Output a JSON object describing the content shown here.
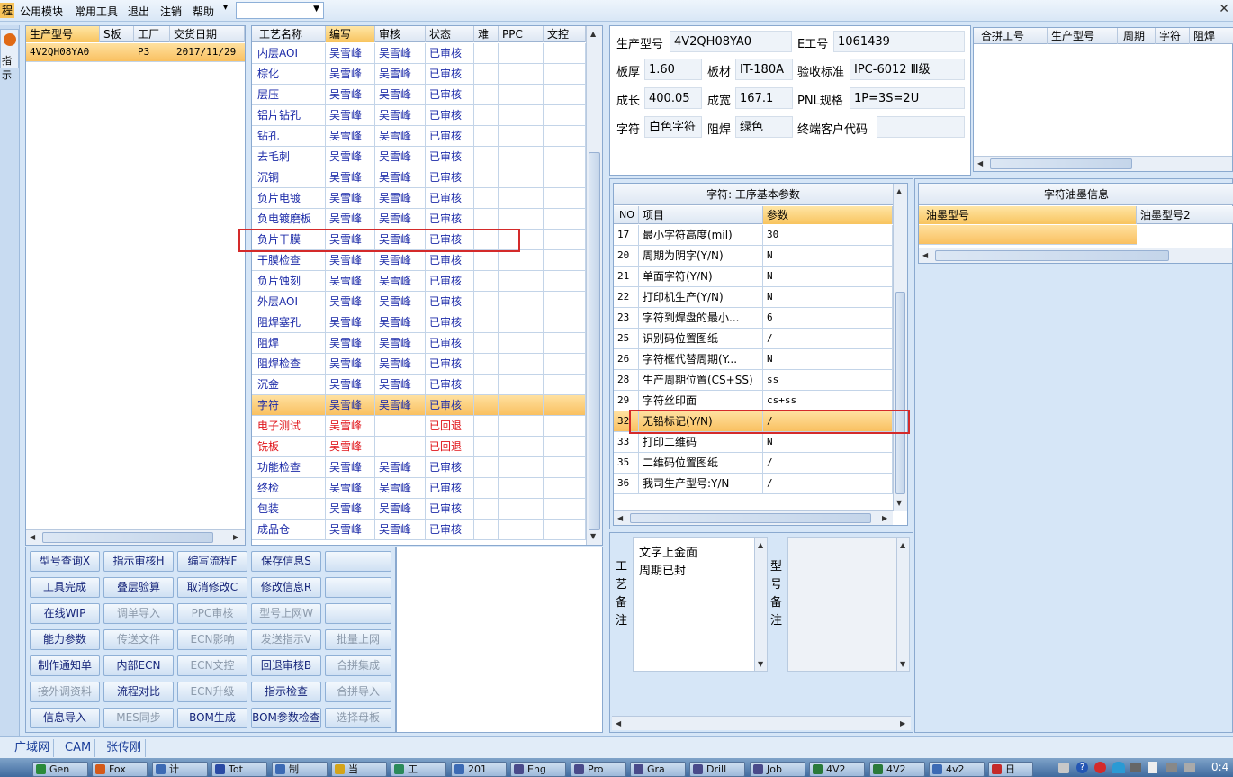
{
  "menu": {
    "partial_left": "程",
    "items": [
      "公用模块",
      "常用工具",
      "退出",
      "注销",
      "帮助"
    ],
    "arrow": "▾"
  },
  "left_strip": {
    "label": "指示"
  },
  "model_list": {
    "columns": [
      "生产型号",
      "S板",
      "工厂",
      "交货日期"
    ],
    "rows": [
      [
        "4V2QH08YA0",
        "",
        "P3",
        "2017/11/29"
      ]
    ]
  },
  "process_table": {
    "columns": [
      "工艺名称",
      "编写",
      "审核",
      "状态",
      "难",
      "PPC",
      "文控"
    ],
    "rows": [
      {
        "name": "内层AOI",
        "writer": "吴雪峰",
        "reviewer": "吴雪峰",
        "status": "已审核"
      },
      {
        "name": "棕化",
        "writer": "吴雪峰",
        "reviewer": "吴雪峰",
        "status": "已审核"
      },
      {
        "name": "层压",
        "writer": "吴雪峰",
        "reviewer": "吴雪峰",
        "status": "已审核"
      },
      {
        "name": "铝片钻孔",
        "writer": "吴雪峰",
        "reviewer": "吴雪峰",
        "status": "已审核"
      },
      {
        "name": "钻孔",
        "writer": "吴雪峰",
        "reviewer": "吴雪峰",
        "status": "已审核"
      },
      {
        "name": "去毛刺",
        "writer": "吴雪峰",
        "reviewer": "吴雪峰",
        "status": "已审核"
      },
      {
        "name": "沉铜",
        "writer": "吴雪峰",
        "reviewer": "吴雪峰",
        "status": "已审核"
      },
      {
        "name": "负片电镀",
        "writer": "吴雪峰",
        "reviewer": "吴雪峰",
        "status": "已审核"
      },
      {
        "name": "负电镀磨板",
        "writer": "吴雪峰",
        "reviewer": "吴雪峰",
        "status": "已审核"
      },
      {
        "name": "负片干膜",
        "writer": "吴雪峰",
        "reviewer": "吴雪峰",
        "status": "已审核"
      },
      {
        "name": "干膜检查",
        "writer": "吴雪峰",
        "reviewer": "吴雪峰",
        "status": "已审核"
      },
      {
        "name": "负片蚀刻",
        "writer": "吴雪峰",
        "reviewer": "吴雪峰",
        "status": "已审核"
      },
      {
        "name": "外层AOI",
        "writer": "吴雪峰",
        "reviewer": "吴雪峰",
        "status": "已审核"
      },
      {
        "name": "阻焊塞孔",
        "writer": "吴雪峰",
        "reviewer": "吴雪峰",
        "status": "已审核"
      },
      {
        "name": "阻焊",
        "writer": "吴雪峰",
        "reviewer": "吴雪峰",
        "status": "已审核"
      },
      {
        "name": "阻焊检查",
        "writer": "吴雪峰",
        "reviewer": "吴雪峰",
        "status": "已审核"
      },
      {
        "name": "沉金",
        "writer": "吴雪峰",
        "reviewer": "吴雪峰",
        "status": "已审核"
      },
      {
        "name": "字符",
        "writer": "吴雪峰",
        "reviewer": "吴雪峰",
        "status": "已审核"
      },
      {
        "name": "电子测试",
        "writer": "吴雪峰",
        "reviewer": "",
        "status": "已回退"
      },
      {
        "name": "铣板",
        "writer": "吴雪峰",
        "reviewer": "",
        "status": "已回退"
      },
      {
        "name": "功能检查",
        "writer": "吴雪峰",
        "reviewer": "吴雪峰",
        "status": "已审核"
      },
      {
        "name": "终检",
        "writer": "吴雪峰",
        "reviewer": "吴雪峰",
        "status": "已审核"
      },
      {
        "name": "包装",
        "writer": "吴雪峰",
        "reviewer": "吴雪峰",
        "status": "已审核"
      },
      {
        "name": "成品仓",
        "writer": "吴雪峰",
        "reviewer": "吴雪峰",
        "status": "已审核"
      }
    ]
  },
  "buttons": [
    [
      "型号查询X",
      "指示审核H",
      "编写流程F",
      "保存信息S",
      ""
    ],
    [
      "工具完成",
      "叠层验算",
      "取消修改C",
      "修改信息R",
      ""
    ],
    [
      "在线WIP",
      "调单导入",
      "PPC审核",
      "型号上网W",
      ""
    ],
    [
      "能力参数",
      "传送文件",
      "ECN影响",
      "发送指示V",
      "批量上网"
    ],
    [
      "制作通知单",
      "内部ECN",
      "ECN文控",
      "回退审核B",
      "合拼集成"
    ],
    [
      "接外调资料",
      "流程对比",
      "ECN升级",
      "指示检查",
      "合拼导入"
    ],
    [
      "信息导入",
      "MES同步",
      "BOM生成",
      "BOM参数检查",
      "选择母板"
    ]
  ],
  "buttons_disabled": [
    [
      false,
      false,
      false,
      false,
      false
    ],
    [
      false,
      false,
      false,
      false,
      false
    ],
    [
      false,
      true,
      true,
      true,
      false
    ],
    [
      false,
      true,
      true,
      true,
      true
    ],
    [
      false,
      false,
      true,
      false,
      true
    ],
    [
      true,
      false,
      true,
      false,
      true
    ],
    [
      false,
      true,
      false,
      false,
      true
    ]
  ],
  "info": {
    "model_label": "生产型号",
    "model": "4V2QH08YA0",
    "eng_label": "E工号",
    "eng": "1061439",
    "thick_label": "板厚",
    "thick": "1.60",
    "mat_label": "板材",
    "mat": "IT-180A",
    "std_label": "验收标准",
    "std": "IPC-6012 Ⅲ级",
    "len_label": "成长",
    "len": "400.05",
    "wid_label": "成宽",
    "wid": "167.1",
    "pnl_label": "PNL规格",
    "pnl": "1P=3S=2U",
    "char_label": "字符",
    "char": "白色字符",
    "mask_label": "阻焊",
    "mask": "绿色",
    "cust_label": "终端客户代码",
    "cust": ""
  },
  "merge_table": {
    "columns": [
      "合拼工号",
      "生产型号",
      "周期",
      "字符",
      "阻焊"
    ]
  },
  "params": {
    "title": "字符: 工序基本参数",
    "columns": [
      "NO",
      "项目",
      "参数"
    ],
    "rows": [
      [
        "17",
        "最小字符高度(mil)",
        "30"
      ],
      [
        "20",
        "周期为阴字(Y/N)",
        "N"
      ],
      [
        "21",
        "单面字符(Y/N)",
        "N"
      ],
      [
        "22",
        "打印机生产(Y/N)",
        "N"
      ],
      [
        "23",
        "字符到焊盘的最小...",
        "6"
      ],
      [
        "25",
        "识别码位置图纸",
        "/"
      ],
      [
        "26",
        "字符框代替周期(Y...",
        "N"
      ],
      [
        "28",
        "生产周期位置(CS+SS)",
        "ss"
      ],
      [
        "29",
        "字符丝印面",
        "cs+ss"
      ],
      [
        "32",
        "无铅标记(Y/N)",
        "/"
      ],
      [
        "33",
        "打印二维码",
        "N"
      ],
      [
        "35",
        "二维码位置图纸",
        "/"
      ],
      [
        "36",
        "我司生产型号:Y/N",
        "/"
      ]
    ]
  },
  "ink": {
    "title": "字符油墨信息",
    "columns": [
      "油墨型号",
      "油墨型号2"
    ]
  },
  "remarks": {
    "process_label": "工艺备注",
    "process_lines": [
      "文字上金面",
      "周期已封"
    ],
    "model_label": "型号备注"
  },
  "statusbar": [
    "广域网",
    "CAM",
    "张传刚"
  ],
  "taskbar": [
    "Gen",
    "Fox",
    "计",
    "Tot",
    "制",
    "当",
    "工",
    "201",
    "Eng",
    "Pro",
    "Gra",
    "Drill",
    "Job",
    "4V2",
    "4V2",
    "4v2",
    "日"
  ],
  "tray": {
    "clock": "0:4"
  }
}
